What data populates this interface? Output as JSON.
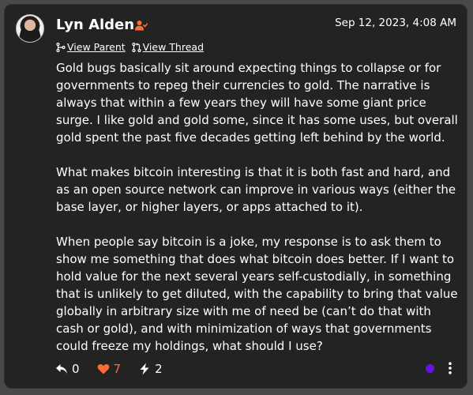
{
  "post": {
    "author": "Lyn Alden",
    "timestamp": "Sep 12, 2023, 4:08 AM",
    "view_parent": "View Parent",
    "view_thread": "View Thread",
    "paragraphs": [
      "Gold bugs basically sit around expecting things to collapse or for governments to repeg their currencies to gold. The narrative is always that within a few years they will have some giant price surge. I like gold and gold some, since it has some uses, but overall gold spent the past five decades getting left behind by the world.",
      "What makes bitcoin interesting is that it is both fast and hard, and as an open source network can improve in various ways (either the base layer, or higher layers, or apps attached to it).",
      "When people say bitcoin is a joke, my response is to ask them to show me something that does what bitcoin does better. If I want to hold value for the next several years self-custodially, in something that is unlikely to get diluted, with the capability to bring that value globally in arbitrary size with me of need be (can’t do that with cash or gold), and with minimization of ways that governments could freeze my holdings, what should I use?"
    ],
    "replies": "0",
    "likes": "7",
    "zaps": "2"
  },
  "colors": {
    "accent": "#ff6b35",
    "status_dot": "#6a12e8",
    "background": "#232323"
  },
  "icons": {
    "follow": "person-check-icon",
    "parent": "branch-icon",
    "thread": "pull-request-icon",
    "reply": "reply-icon",
    "like": "heart-icon",
    "zap": "lightning-icon",
    "more": "more-vertical-icon"
  }
}
